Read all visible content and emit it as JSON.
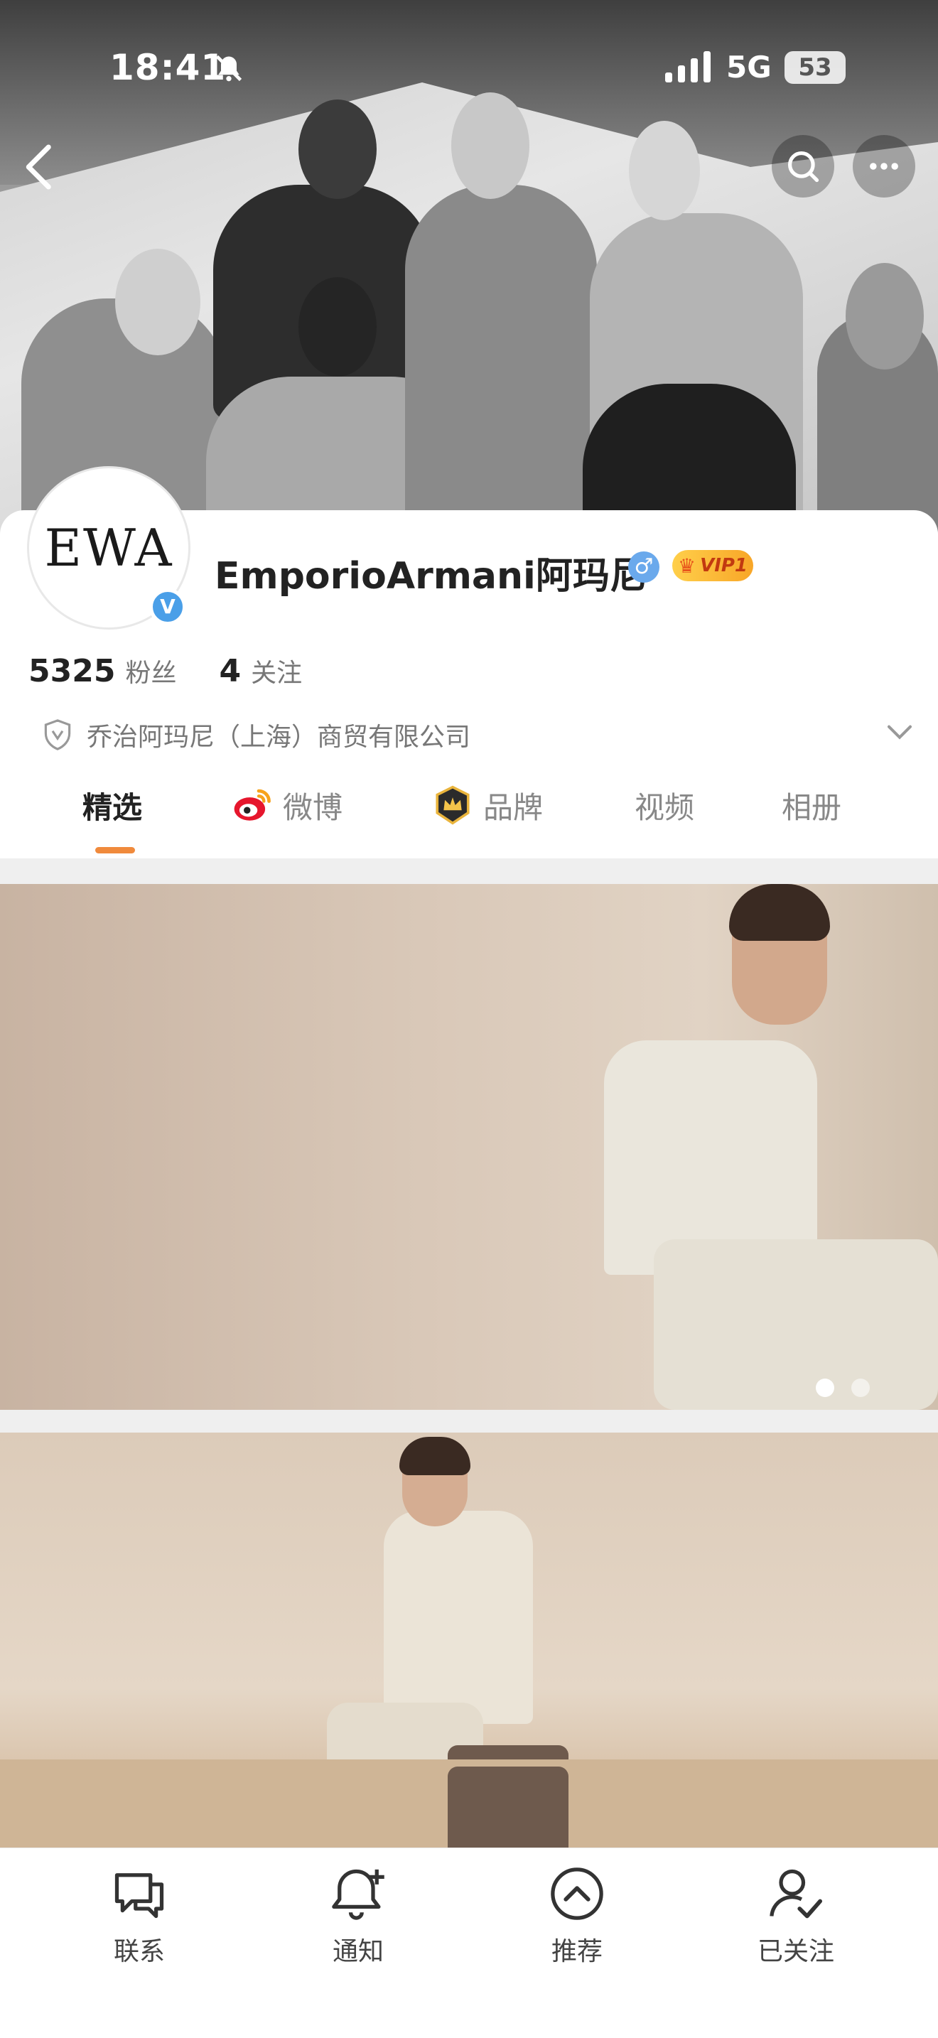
{
  "status_bar": {
    "time": "18:41",
    "network": "5G",
    "battery": "53"
  },
  "header": {
    "back_icon": "chevron-left-icon",
    "search_icon": "search-icon",
    "more_icon": "more-icon"
  },
  "profile": {
    "avatar_text": "EWA",
    "verified_badge": "V",
    "name": "EmporioArmani阿玛尼",
    "gender_symbol": "♂",
    "vip_label": "VIP1",
    "followers_count": "5325",
    "followers_label": "粉丝",
    "following_count": "4",
    "following_label": "关注",
    "company": "乔治阿玛尼（上海）商贸有限公司"
  },
  "tabs": [
    {
      "label": "精选",
      "active": true
    },
    {
      "label": "微博",
      "icon": "weibo-icon"
    },
    {
      "label": "品牌",
      "icon": "brand-crown-icon"
    },
    {
      "label": "视频"
    },
    {
      "label": "相册"
    }
  ],
  "carousel": {
    "total": 2,
    "current": 1
  },
  "bottom_bar": [
    {
      "label": "联系",
      "icon": "chat-icon"
    },
    {
      "label": "通知",
      "icon": "bell-add-icon"
    },
    {
      "label": "推荐",
      "icon": "up-circle-icon"
    },
    {
      "label": "已关注",
      "icon": "user-check-icon"
    }
  ],
  "colors": {
    "accent": "#f08a3c",
    "verified": "#4a9fe8",
    "vip_gold": "#ffcf4a"
  }
}
